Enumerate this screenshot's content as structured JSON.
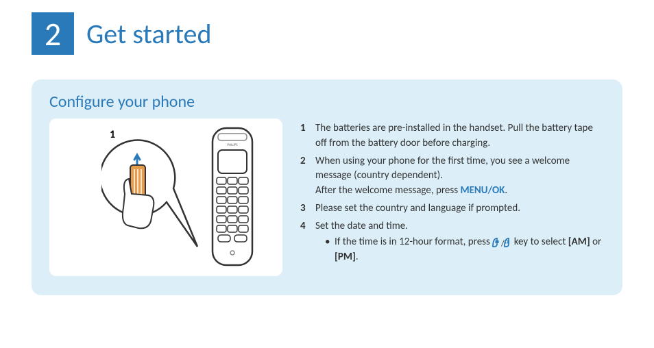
{
  "header": {
    "chapter_number": "2",
    "chapter_title": "Get started"
  },
  "section": {
    "title": "Configure your phone",
    "illustration_step_label": "1",
    "steps": {
      "s1": "The batteries are pre-installed in the handset. Pull the battery tape off from the battery door before charging.",
      "s2a": "When using your phone for the first time, you see a welcome message (country dependent).",
      "s2b_prefix": "After the welcome message, press ",
      "s2b_button": "MENU/OK",
      "s2b_suffix": ".",
      "s3": "Please set the country and language if prompted.",
      "s4": "Set the date and time.",
      "s4_sub_prefix": "If the time is in 12-hour format, press ",
      "s4_sub_mid": " key to select ",
      "s4_sub_am": "[AM]",
      "s4_sub_or": " or ",
      "s4_sub_pm": "[PM]",
      "s4_sub_suffix": "."
    }
  },
  "icons": {
    "key_icon": "phonebook-redial-key-icon",
    "handset_icon": "cordless-handset-icon",
    "battery_pull_icon": "battery-tape-pull-icon"
  },
  "colors": {
    "accent": "#2a7ab9",
    "panel": "#dceff8"
  }
}
